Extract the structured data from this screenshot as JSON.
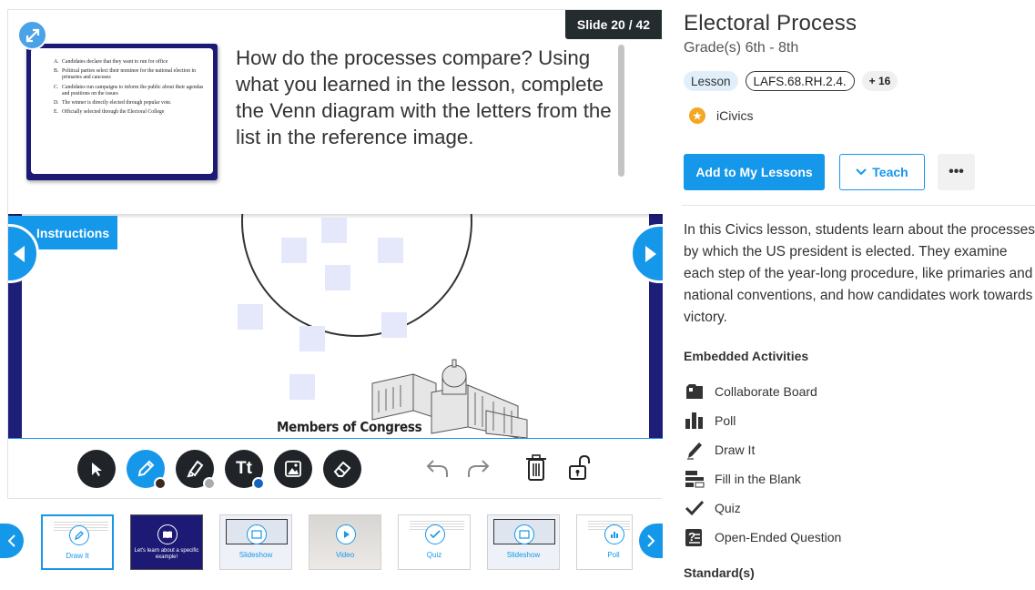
{
  "viewer": {
    "slide_counter": "Slide 20 / 42",
    "prompt": "How do the processes compare? Using what you learned in the lesson, complete the Venn diagram with the letters from the list in the reference image.",
    "reference_items": [
      {
        "letter": "A.",
        "text": "Candidates declare that they want to run for office"
      },
      {
        "letter": "B.",
        "text": "Political parties select their nominee for the national election in primaries and caucuses"
      },
      {
        "letter": "C.",
        "text": "Candidates run campaigns to inform the public about their agendas and positions on the issues"
      },
      {
        "letter": "D.",
        "text": "The winner is directly elected through popular vote."
      },
      {
        "letter": "E.",
        "text": "Officially selected through the Electoral College"
      }
    ],
    "instructions_label": "Instructions",
    "board_caption": "Members of Congress"
  },
  "toolbar": {
    "tools": [
      "select",
      "draw",
      "highlight",
      "text",
      "image",
      "eraser"
    ],
    "active_tool": "draw",
    "draw_color": "#3a2a20",
    "highlight_color": "#aaaaaa",
    "text_color": "#1565c0"
  },
  "filmstrip": {
    "thumbs": [
      {
        "label": "Draw It",
        "kind": "draw",
        "selected": true
      },
      {
        "label": "Let's learn about a specific example!",
        "kind": "dark"
      },
      {
        "label": "Slideshow",
        "kind": "slideshow"
      },
      {
        "label": "Video",
        "kind": "video"
      },
      {
        "label": "Quiz",
        "kind": "quiz"
      },
      {
        "label": "Slideshow",
        "kind": "slideshow"
      },
      {
        "label": "Poll",
        "kind": "poll"
      }
    ]
  },
  "details": {
    "title": "Electoral Process",
    "grades": "Grade(s) 6th - 8th",
    "tags": {
      "type": "Lesson",
      "standard": "LAFS.68.RH.2.4.",
      "more": "+ 16"
    },
    "provider": "iCivics",
    "buttons": {
      "add": "Add to My Lessons",
      "teach": "Teach",
      "more": "•••"
    },
    "description": "In this Civics lesson, students learn about the processes by which the US president is elected. They examine each step of the year-long procedure, like primaries and national conventions, and how candidates work towards victory.",
    "activities_heading": "Embedded Activities",
    "activities": [
      {
        "label": "Collaborate Board",
        "icon": "board-icon"
      },
      {
        "label": "Poll",
        "icon": "poll-icon"
      },
      {
        "label": "Draw It",
        "icon": "pencil-icon"
      },
      {
        "label": "Fill in the Blank",
        "icon": "fill-blank-icon"
      },
      {
        "label": "Quiz",
        "icon": "check-icon"
      },
      {
        "label": "Open-Ended Question",
        "icon": "open-question-icon"
      }
    ],
    "standards_heading": "Standard(s)"
  },
  "colors": {
    "accent": "#1597ea",
    "slide_frame": "#1e1e78",
    "dark_tool": "#202428",
    "badge": "#252c30"
  }
}
